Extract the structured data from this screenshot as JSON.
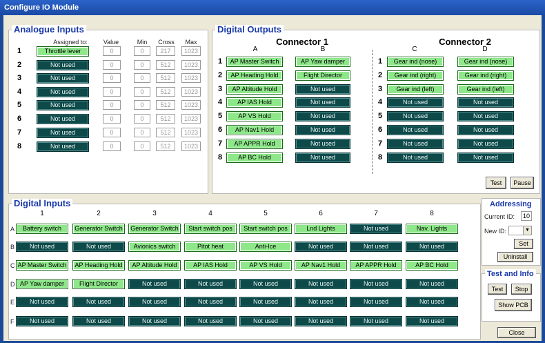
{
  "window": {
    "title": "Configure IO Module"
  },
  "analogue": {
    "title": "Analogue Inputs",
    "headers": {
      "assigned": "Assigned to:",
      "value": "Value",
      "min": "Min",
      "cross": "Cross",
      "max": "Max"
    },
    "rows": [
      {
        "n": "1",
        "assigned": "Throttle lever",
        "on": true,
        "value": "0",
        "min": "0",
        "cross": "217",
        "max": "1023"
      },
      {
        "n": "2",
        "assigned": "Not used",
        "on": false,
        "value": "0",
        "min": "0",
        "cross": "512",
        "max": "1023"
      },
      {
        "n": "3",
        "assigned": "Not used",
        "on": false,
        "value": "0",
        "min": "0",
        "cross": "512",
        "max": "1023"
      },
      {
        "n": "4",
        "assigned": "Not used",
        "on": false,
        "value": "0",
        "min": "0",
        "cross": "512",
        "max": "1023"
      },
      {
        "n": "5",
        "assigned": "Not used",
        "on": false,
        "value": "0",
        "min": "0",
        "cross": "512",
        "max": "1023"
      },
      {
        "n": "6",
        "assigned": "Not used",
        "on": false,
        "value": "0",
        "min": "0",
        "cross": "512",
        "max": "1023"
      },
      {
        "n": "7",
        "assigned": "Not used",
        "on": false,
        "value": "0",
        "min": "0",
        "cross": "512",
        "max": "1023"
      },
      {
        "n": "8",
        "assigned": "Not used",
        "on": false,
        "value": "0",
        "min": "0",
        "cross": "512",
        "max": "1023"
      }
    ]
  },
  "digital_outputs": {
    "title": "Digital Outputs",
    "connector1": {
      "title": "Connector 1",
      "col_a": "A",
      "col_b": "B"
    },
    "connector2": {
      "title": "Connector 2",
      "col_c": "C",
      "col_d": "D"
    },
    "row_numbers": [
      "1",
      "2",
      "3",
      "4",
      "5",
      "6",
      "7",
      "8"
    ],
    "a": [
      [
        "AP Master Switch",
        true
      ],
      [
        "AP Heading Hold",
        true
      ],
      [
        "AP Altitude Hold",
        true
      ],
      [
        "AP IAS Hold",
        true
      ],
      [
        "AP VS Hold",
        true
      ],
      [
        "AP Nav1 Hold",
        true
      ],
      [
        "AP APPR Hold",
        true
      ],
      [
        "AP BC Hold",
        true
      ]
    ],
    "b": [
      [
        "AP Yaw damper",
        true
      ],
      [
        "Flight Director",
        true
      ],
      [
        "Not used",
        false
      ],
      [
        "Not used",
        false
      ],
      [
        "Not used",
        false
      ],
      [
        "Not used",
        false
      ],
      [
        "Not used",
        false
      ],
      [
        "Not used",
        false
      ]
    ],
    "c": [
      [
        "Gear ind (nose)",
        true
      ],
      [
        "Gear ind (right)",
        true
      ],
      [
        "Gear ind (left)",
        true
      ],
      [
        "Not used",
        false
      ],
      [
        "Not used",
        false
      ],
      [
        "Not used",
        false
      ],
      [
        "Not used",
        false
      ],
      [
        "Not used",
        false
      ]
    ],
    "d": [
      [
        "Gear ind (nose)",
        true
      ],
      [
        "Gear ind (right)",
        true
      ],
      [
        "Gear ind (left)",
        true
      ],
      [
        "Not used",
        false
      ],
      [
        "Not used",
        false
      ],
      [
        "Not used",
        false
      ],
      [
        "Not used",
        false
      ],
      [
        "Not used",
        false
      ]
    ],
    "test_label": "Test",
    "pause_label": "Pause"
  },
  "digital_inputs": {
    "title": "Digital Inputs",
    "col_headers": [
      "1",
      "2",
      "3",
      "4",
      "5",
      "6",
      "7",
      "8"
    ],
    "row_letters": [
      "A",
      "B",
      "C",
      "D",
      "E",
      "F"
    ],
    "rows": [
      [
        [
          "Battery switch",
          true
        ],
        [
          "Generator Switch",
          true
        ],
        [
          "Generator Switch",
          true
        ],
        [
          "Start switch pos",
          true
        ],
        [
          "Start switch pos",
          true
        ],
        [
          "Lnd Lights",
          true
        ],
        [
          "Not used",
          false
        ],
        [
          "Nav. Lights",
          true
        ]
      ],
      [
        [
          "Not used",
          false
        ],
        [
          "Not used",
          false
        ],
        [
          "Avionics switch",
          true
        ],
        [
          "Pitot heat",
          true
        ],
        [
          "Anti-Ice",
          true
        ],
        [
          "Not used",
          false
        ],
        [
          "Not used",
          false
        ],
        [
          "Not used",
          false
        ]
      ],
      [
        [
          "AP Master Switch",
          true
        ],
        [
          "AP Heading Hold",
          true
        ],
        [
          "AP Altitude Hold",
          true
        ],
        [
          "AP IAS Hold",
          true
        ],
        [
          "AP VS Hold",
          true
        ],
        [
          "AP Nav1 Hold",
          true
        ],
        [
          "AP APPR Hold",
          true
        ],
        [
          "AP BC Hold",
          true
        ]
      ],
      [
        [
          "AP Yaw damper",
          true
        ],
        [
          "Flight Director",
          true
        ],
        [
          "Not used",
          false
        ],
        [
          "Not used",
          false
        ],
        [
          "Not used",
          false
        ],
        [
          "Not used",
          false
        ],
        [
          "Not used",
          false
        ],
        [
          "Not used",
          false
        ]
      ],
      [
        [
          "Not used",
          false
        ],
        [
          "Not used",
          false
        ],
        [
          "Not used",
          false
        ],
        [
          "Not used",
          false
        ],
        [
          "Not used",
          false
        ],
        [
          "Not used",
          false
        ],
        [
          "Not used",
          false
        ],
        [
          "Not used",
          false
        ]
      ],
      [
        [
          "Not used",
          false
        ],
        [
          "Not used",
          false
        ],
        [
          "Not used",
          false
        ],
        [
          "Not used",
          false
        ],
        [
          "Not used",
          false
        ],
        [
          "Not used",
          false
        ],
        [
          "Not used",
          false
        ],
        [
          "Not used",
          false
        ]
      ]
    ]
  },
  "addressing": {
    "title": "Addressing",
    "current_id_label": "Current ID:",
    "current_id_value": "10",
    "new_id_label": "New ID:",
    "new_id_value": "",
    "set_label": "Set",
    "uninstall_label": "Uninstall"
  },
  "test_info": {
    "title": "Test and Info",
    "test_label": "Test",
    "stop_label": "Stop",
    "show_pcb_label": "Show PCB"
  },
  "close_label": "Close",
  "colors": {
    "active_green": "#8ee88a",
    "inactive_teal": "#0f4a4a",
    "group_title_blue": "#1a3aa8"
  }
}
